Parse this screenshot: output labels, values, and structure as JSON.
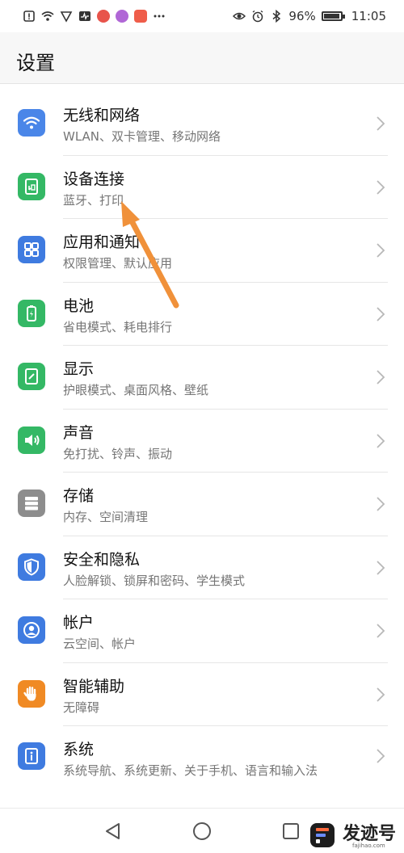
{
  "status_bar": {
    "battery": "96%",
    "time": "11:05",
    "battery_level": 0.96
  },
  "header": {
    "title": "设置"
  },
  "settings": [
    {
      "title": "无线和网络",
      "subtitle": "WLAN、双卡管理、移动网络",
      "icon": "wifi-icon",
      "color": "#4a86e8"
    },
    {
      "title": "设备连接",
      "subtitle": "蓝牙、打印",
      "icon": "device-connection-icon",
      "color": "#34b865"
    },
    {
      "title": "应用和通知",
      "subtitle": "权限管理、默认应用",
      "icon": "apps-grid-icon",
      "color": "#3f7be0"
    },
    {
      "title": "电池",
      "subtitle": "省电模式、耗电排行",
      "icon": "battery-icon",
      "color": "#34b865"
    },
    {
      "title": "显示",
      "subtitle": "护眼模式、桌面风格、壁纸",
      "icon": "display-icon",
      "color": "#34b865"
    },
    {
      "title": "声音",
      "subtitle": "免打扰、铃声、振动",
      "icon": "sound-icon",
      "color": "#34b865"
    },
    {
      "title": "存储",
      "subtitle": "内存、空间清理",
      "icon": "storage-icon",
      "color": "#8d8d8d"
    },
    {
      "title": "安全和隐私",
      "subtitle": "人脸解锁、锁屏和密码、学生模式",
      "icon": "shield-icon",
      "color": "#3f7be0"
    },
    {
      "title": "帐户",
      "subtitle": "云空间、帐户",
      "icon": "account-icon",
      "color": "#3f7be0"
    },
    {
      "title": "智能辅助",
      "subtitle": "无障碍",
      "icon": "hand-icon",
      "color": "#f08a24"
    },
    {
      "title": "系统",
      "subtitle": "系统导航、系统更新、关于手机、语言和输入法",
      "icon": "system-info-icon",
      "color": "#3f7be0"
    }
  ],
  "watermark": {
    "text": "发迹号",
    "url": "fajihao.com"
  },
  "colors": {
    "arrow": "#f0913a",
    "chevron": "#b8b8b8"
  }
}
